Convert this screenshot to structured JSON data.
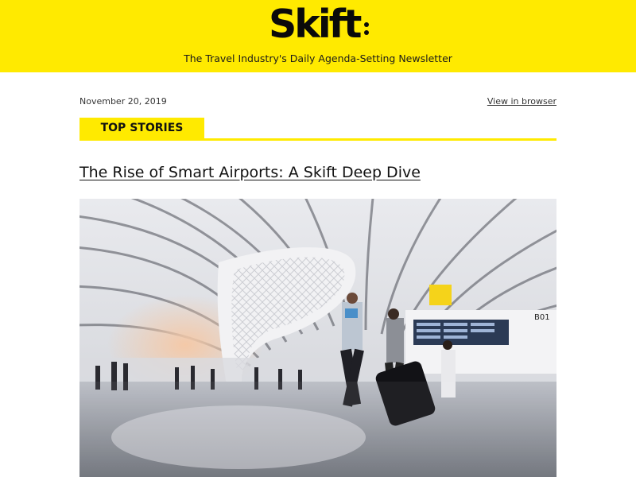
{
  "header": {
    "logo_text": "Skift",
    "tagline": "The Travel Industry's Daily Agenda-Setting Newsletter",
    "brand_color": "#ffea00"
  },
  "meta": {
    "date": "November 20, 2019",
    "view_in_browser": "View in browser"
  },
  "section": {
    "label": "TOP STORIES"
  },
  "story": {
    "headline": "The Rise of Smart Airports: A Skift Deep Dive",
    "image_signage": "B01"
  }
}
